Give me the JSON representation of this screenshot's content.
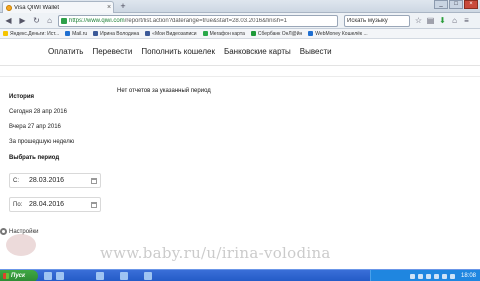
{
  "browser": {
    "tab_title": "Visa QIWI Wallet",
    "tab_close": "×",
    "new_tab": "+",
    "url_host": "https://www.qiwi.com",
    "url_path": "/report/list.action?daterange=true&start=28.03.2016&finish=1",
    "search_text": "Искать музыку",
    "window_buttons": [
      "_",
      "□",
      "×"
    ]
  },
  "bookmarks": [
    {
      "label": "Яндекс.Деньги: Ист...",
      "color": "#f5c400"
    },
    {
      "label": "Mail.ru",
      "color": "#1f6fd1"
    },
    {
      "label": "Ирина Володина",
      "color": "#3b5998"
    },
    {
      "label": "«Мои Видеозаписи",
      "color": "#3b5998"
    },
    {
      "label": "Мегафон карта",
      "color": "#2aa84a"
    },
    {
      "label": "Сбербанк ОнЛ@йн",
      "color": "#1f9a3a"
    },
    {
      "label": "WebMoney Кошелёк ...",
      "color": "#1f6fd1"
    }
  ],
  "site_nav": {
    "links": [
      "Оплатить",
      "Перевести",
      "Пополнить кошелек",
      "Банковские карты",
      "Вывести"
    ]
  },
  "main": {
    "no_reports": "Нет отчетов за указанный период"
  },
  "sidebar": {
    "title": "История",
    "items": [
      "Сегодня 28 апр 2016",
      "Вчера 27 апр 2016",
      "За прошедшую неделю"
    ],
    "period_title": "Выбрать период",
    "from_label": "С:",
    "from_value": "28.03.2016",
    "to_label": "По:",
    "to_value": "28.04.2016",
    "settings_label": "Настройки"
  },
  "watermark": "www.baby.ru/u/irina-volodina",
  "taskbar": {
    "start_label": "Пуск",
    "clock": "18:08"
  }
}
